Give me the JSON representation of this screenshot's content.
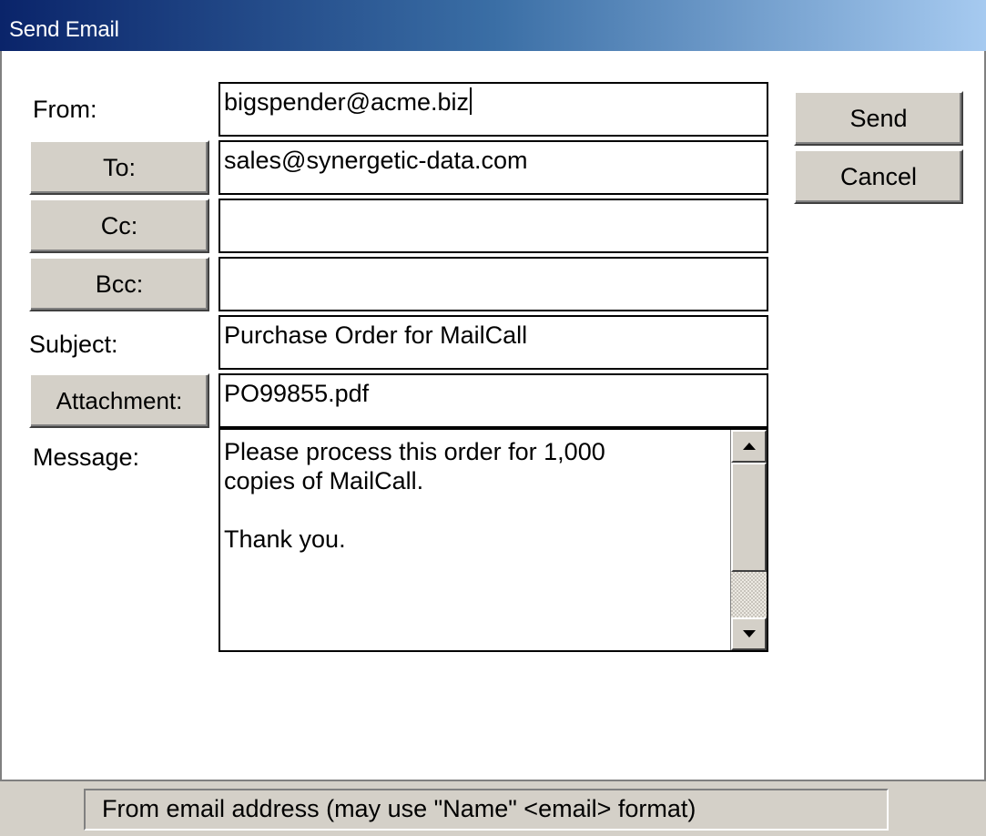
{
  "window": {
    "title": "Send Email"
  },
  "form": {
    "from_label": "From:",
    "from_value": "bigspender@acme.biz",
    "to_button": "To:",
    "to_value": "sales@synergetic-data.com",
    "cc_button": "Cc:",
    "cc_value": "",
    "bcc_button": "Bcc:",
    "bcc_value": "",
    "subject_label": "Subject:",
    "subject_value": "Purchase Order for MailCall",
    "attachment_button": "Attachment:",
    "attachment_value": "PO99855.pdf",
    "message_label": "Message:",
    "message_value": "Please process this order for 1,000\ncopies of MailCall.\n\nThank you."
  },
  "actions": {
    "send_label": "Send",
    "cancel_label": "Cancel"
  },
  "status": {
    "text": "From email address (may use \"Name\" <email> format)"
  },
  "icons": {
    "scroll_up": "scroll-up-arrow-icon",
    "scroll_down": "scroll-down-arrow-icon"
  }
}
